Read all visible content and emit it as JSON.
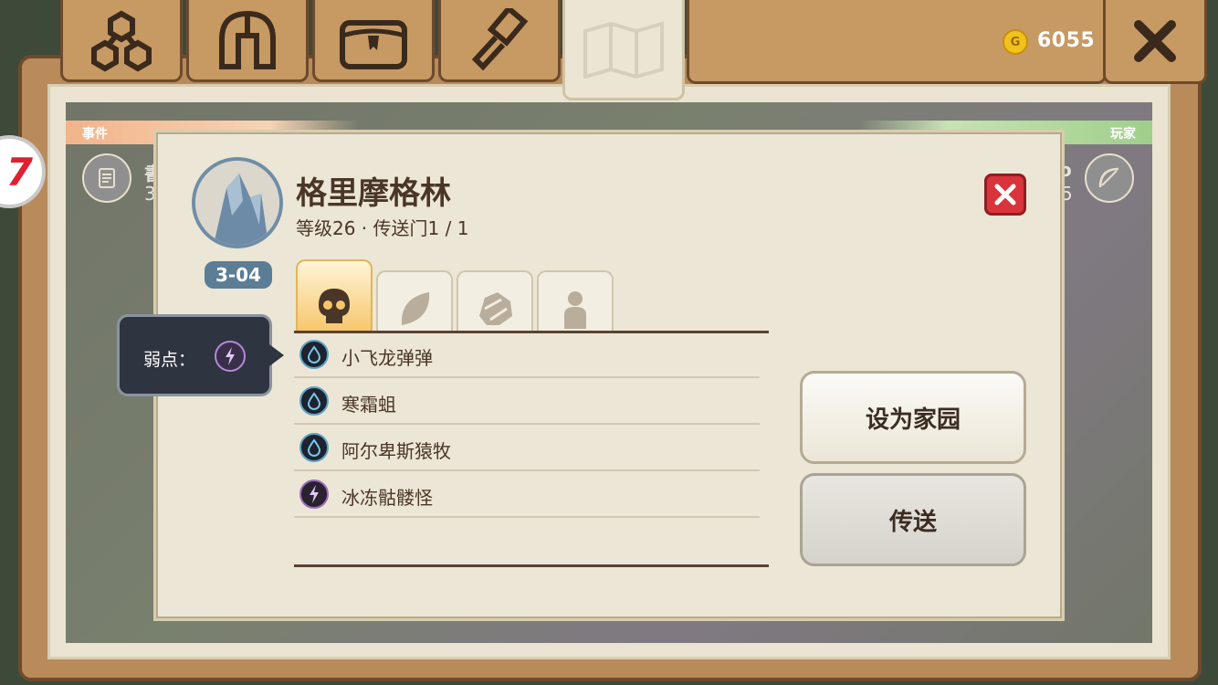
{
  "currency": {
    "icon": "gold-coin-icon",
    "amount": "6055"
  },
  "tabs": [
    {
      "name": "tab-resources",
      "icon": "resources-icon"
    },
    {
      "name": "tab-helmet",
      "icon": "helmet-icon"
    },
    {
      "name": "tab-chest",
      "icon": "chest-icon"
    },
    {
      "name": "tab-hammer",
      "icon": "hammer-icon"
    },
    {
      "name": "tab-map",
      "icon": "map-icon"
    }
  ],
  "background": {
    "left_bar": "事件",
    "right_bar": "玩家"
  },
  "dialog": {
    "title": "格里摩格林",
    "subtitle": "等级26 · 传送门1 / 1",
    "badge": "3-04",
    "tooltip_label": "弱点：",
    "creatures": [
      {
        "name": "小飞龙弹弹",
        "element": "water"
      },
      {
        "name": "寒霜蛆",
        "element": "water"
      },
      {
        "name": "阿尔卑斯猿牧",
        "element": "water"
      },
      {
        "name": "冰冻骷髅怪",
        "element": "thunder"
      }
    ],
    "buttons": {
      "set_home": "设为家园",
      "teleport": "传送"
    }
  },
  "colors": {
    "wood": "#c79a63",
    "parchment": "#ece6d6",
    "close_red": "#d9343b",
    "badge_blue": "#5b7d96"
  }
}
